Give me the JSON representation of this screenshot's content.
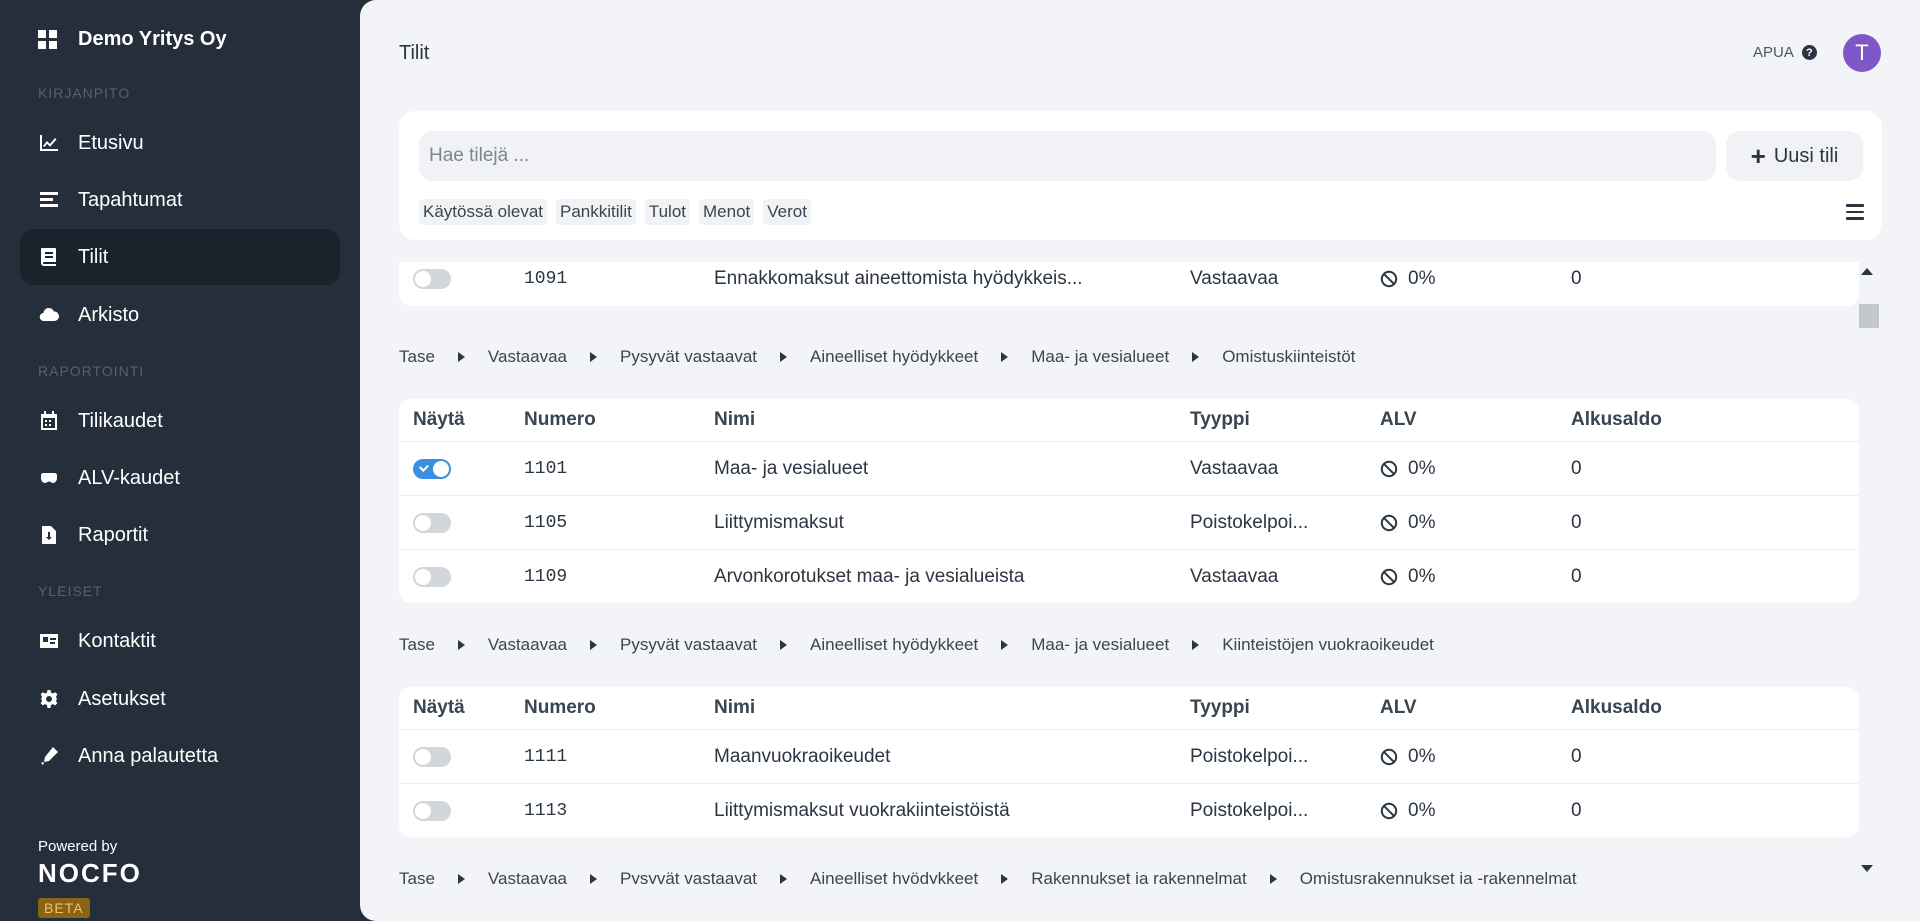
{
  "sidebar": {
    "company": "Demo Yritys Oy",
    "sections": {
      "kirjanpito": "KIRJANPITO",
      "raportointi": "RAPORTOINTI",
      "yleiset": "YLEISET"
    },
    "items": [
      {
        "label": "Etusivu",
        "icon": "chart-line-icon"
      },
      {
        "label": "Tapahtumat",
        "icon": "list-icon"
      },
      {
        "label": "Tilit",
        "icon": "book-icon"
      },
      {
        "label": "Arkisto",
        "icon": "cloud-icon"
      },
      {
        "label": "Tilikaudet",
        "icon": "calendar-icon"
      },
      {
        "label": "ALV-kaudet",
        "icon": "mask-icon"
      },
      {
        "label": "Raportit",
        "icon": "file-download-icon"
      },
      {
        "label": "Kontaktit",
        "icon": "id-card-icon"
      },
      {
        "label": "Asetukset",
        "icon": "gear-icon"
      },
      {
        "label": "Anna palautetta",
        "icon": "pen-icon"
      }
    ],
    "powered_by": "Powered by",
    "brand": "NOCFO",
    "beta": "BETA"
  },
  "header": {
    "title": "Tilit",
    "help": "APUA",
    "help_icon": "?",
    "avatar": "T"
  },
  "search": {
    "placeholder": "Hae tilejä ...",
    "new_button": "Uusi tili",
    "filters": [
      "Käytössä olevat",
      "Pankkitilit",
      "Tulot",
      "Menot",
      "Verot"
    ]
  },
  "columns": {
    "show": "Näytä",
    "number": "Numero",
    "name": "Nimi",
    "type": "Tyyppi",
    "vat": "ALV",
    "balance": "Alkusaldo"
  },
  "groups": {
    "top": {
      "rows": [
        {
          "on": false,
          "number": "1091",
          "name": "Ennakkomaksut aineettomista hyödykkeis...",
          "type": "Vastaavaa",
          "vat": "0%",
          "balance": "0"
        }
      ]
    },
    "g1": {
      "breadcrumb": [
        "Tase",
        "Vastaavaa",
        "Pysyvät vastaavat",
        "Aineelliset hyödykkeet",
        "Maa- ja vesialueet",
        "Omistuskiinteistöt"
      ],
      "rows": [
        {
          "on": true,
          "number": "1101",
          "name": "Maa- ja vesialueet",
          "type": "Vastaavaa",
          "vat": "0%",
          "balance": "0"
        },
        {
          "on": false,
          "number": "1105",
          "name": "Liittymismaksut",
          "type": "Poistokelpoi...",
          "vat": "0%",
          "balance": "0"
        },
        {
          "on": false,
          "number": "1109",
          "name": "Arvonkorotukset maa- ja vesialueista",
          "type": "Vastaavaa",
          "vat": "0%",
          "balance": "0"
        }
      ]
    },
    "g2": {
      "breadcrumb": [
        "Tase",
        "Vastaavaa",
        "Pysyvät vastaavat",
        "Aineelliset hyödykkeet",
        "Maa- ja vesialueet",
        "Kiinteistöjen vuokraoikeudet"
      ],
      "rows": [
        {
          "on": false,
          "number": "1111",
          "name": "Maanvuokraoikeudet",
          "type": "Poistokelpoi...",
          "vat": "0%",
          "balance": "0"
        },
        {
          "on": false,
          "number": "1113",
          "name": "Liittymismaksut vuokrakiinteistöistä",
          "type": "Poistokelpoi...",
          "vat": "0%",
          "balance": "0"
        }
      ]
    },
    "g3": {
      "breadcrumb": [
        "Tase",
        "Vastaavaa",
        "Pysyvät vastaavat",
        "Aineelliset hyödykkeet",
        "Rakennukset ja rakennelmat",
        "Omistusrakennukset ja -rakennelmat"
      ]
    }
  }
}
